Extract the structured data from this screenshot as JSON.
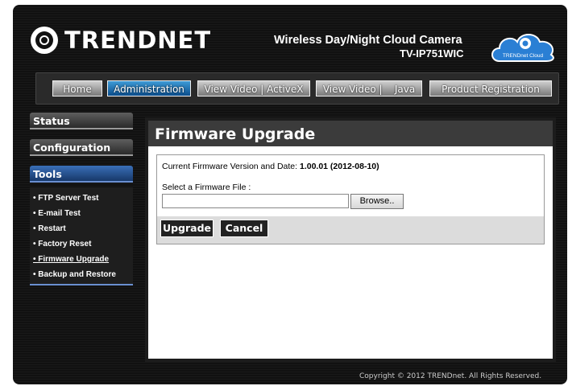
{
  "header": {
    "logo_text": "TRENDNET",
    "product_name": "Wireless Day/Night Cloud Camera",
    "product_model": "TV-IP751WIC",
    "cloud_badge": "TRENDnet Cloud"
  },
  "nav": {
    "items": [
      {
        "label": "Home"
      },
      {
        "label": "Administration"
      },
      {
        "label": "View Video | ActiveX"
      },
      {
        "label": "View Video |    Java"
      },
      {
        "label": "Product Registration"
      }
    ],
    "active": "Administration"
  },
  "sidebar": {
    "sections": [
      {
        "label": "Status"
      },
      {
        "label": "Configuration"
      },
      {
        "label": "Tools"
      }
    ],
    "tools_items": [
      {
        "label": "• FTP Server Test"
      },
      {
        "label": "• E-mail Test"
      },
      {
        "label": "• Restart"
      },
      {
        "label": "• Factory Reset"
      },
      {
        "label": "• Firmware Upgrade"
      },
      {
        "label": "• Backup and Restore"
      }
    ],
    "current_item": "Firmware Upgrade"
  },
  "main": {
    "title": "Firmware Upgrade",
    "fw_version_label": "Current Firmware Version and Date: ",
    "fw_version_value": "1.00.01 (2012-08-10)",
    "select_label": "Select a Firmware File :",
    "file_value": "",
    "browse_label": "Browse..",
    "upgrade_label": "Upgrade",
    "cancel_label": "Cancel"
  },
  "footer": {
    "copyright": "Copyright © 2012 TRENDnet.  All Rights Reserved."
  },
  "colors": {
    "accent_blue": "#1f6fb8",
    "background": "#111111",
    "title_bar": "#3b3b3b"
  }
}
